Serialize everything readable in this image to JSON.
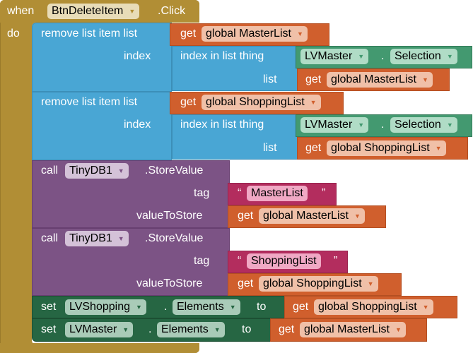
{
  "event": {
    "when": "when",
    "component": "BtnDeleteItem",
    "event_name": ".Click",
    "do": "do"
  },
  "remove1": {
    "label": "remove list item  list",
    "index_label": "index",
    "get": "get",
    "list_var": "global MasterList",
    "index_in_list": "index in list  thing",
    "list_label": "list",
    "component": "LVMaster",
    "dot": ".",
    "property": "Selection",
    "list_var2": "global MasterList"
  },
  "remove2": {
    "label": "remove list item  list",
    "index_label": "index",
    "get": "get",
    "list_var": "global ShoppingList",
    "index_in_list": "index in list  thing",
    "list_label": "list",
    "component": "LVMaster",
    "dot": ".",
    "property": "Selection",
    "list_var2": "global ShoppingList"
  },
  "store1": {
    "call": "call",
    "component": "TinyDB1",
    "method": ".StoreValue",
    "tag_label": "tag",
    "value_label": "valueToStore",
    "open_quote": "“",
    "tag_value": "MasterList",
    "close_quote": "”",
    "get": "get",
    "var": "global MasterList"
  },
  "store2": {
    "call": "call",
    "component": "TinyDB1",
    "method": ".StoreValue",
    "tag_label": "tag",
    "value_label": "valueToStore",
    "open_quote": "“",
    "tag_value": "ShoppingList",
    "close_quote": "”",
    "get": "get",
    "var": "global ShoppingList"
  },
  "set1": {
    "set": "set",
    "component": "LVShopping",
    "dot": ".",
    "property": "Elements",
    "to": "to",
    "get": "get",
    "var": "global ShoppingList"
  },
  "set2": {
    "set": "set",
    "component": "LVMaster",
    "dot": ".",
    "property": "Elements",
    "to": "to",
    "get": "get",
    "var": "global MasterList"
  },
  "icons": {
    "dropdown": "▼"
  }
}
